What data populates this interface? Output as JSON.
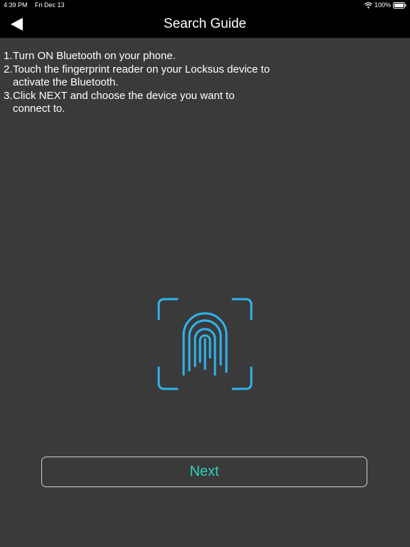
{
  "status_bar": {
    "time": "4:39 PM",
    "date": "Fri Dec 13",
    "battery": "100%"
  },
  "nav": {
    "title": "Search Guide",
    "back_icon": "back-arrow-icon"
  },
  "instructions": [
    {
      "num": "1.",
      "text": "Turn ON Bluetooth on your phone."
    },
    {
      "num": "2.",
      "text": "Touch the fingerprint reader on your Locksus device to activate the Bluetooth."
    },
    {
      "num": "3.",
      "text": "Click NEXT and choose the device you want to connect to."
    }
  ],
  "fingerprint": {
    "icon": "fingerprint-icon",
    "color": "#2fb4ef"
  },
  "next_button": {
    "label": "Next",
    "color": "#2ed1c4"
  }
}
